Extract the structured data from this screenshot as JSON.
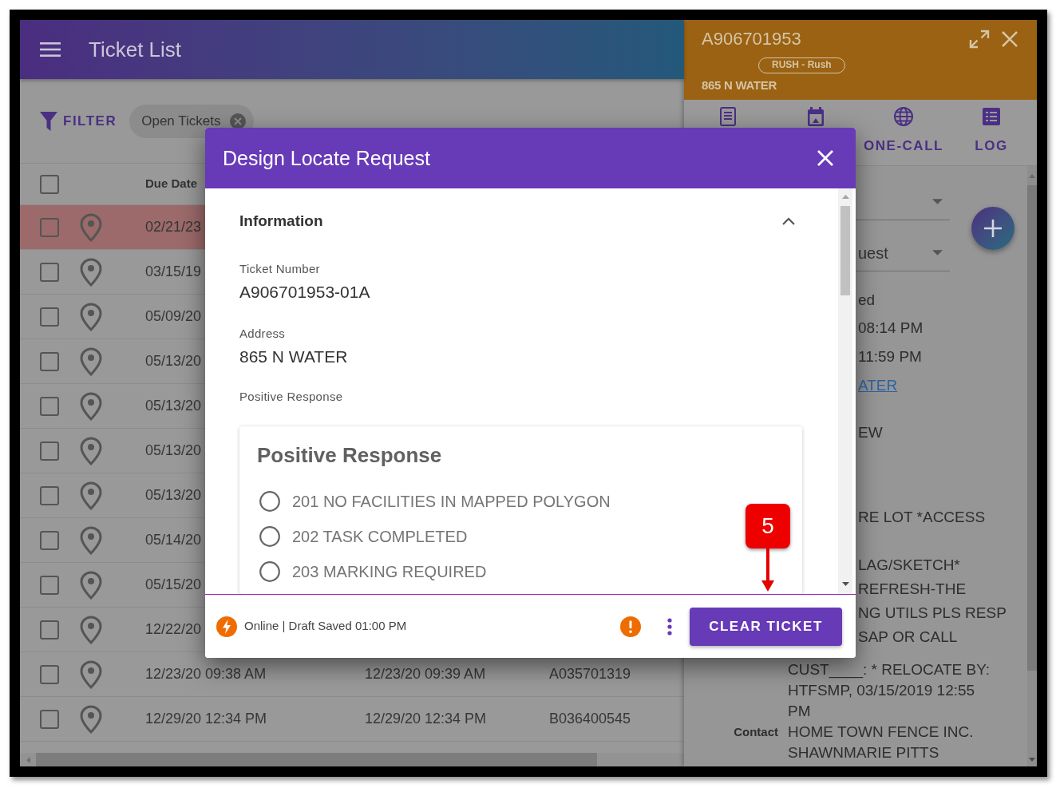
{
  "app_bar": {
    "title": "Ticket List"
  },
  "ticket_list": {
    "filter_label": "FILTER",
    "filter_chip": "Open Tickets",
    "all_checked": false,
    "columns": [
      "Due Date"
    ],
    "rows": [
      {
        "highlighted": true,
        "checked": false,
        "cells": [
          "02/21/23"
        ]
      },
      {
        "highlighted": false,
        "checked": false,
        "cells": [
          "03/15/19"
        ]
      },
      {
        "highlighted": false,
        "checked": false,
        "cells": [
          "05/09/20"
        ]
      },
      {
        "highlighted": false,
        "checked": false,
        "cells": [
          "05/13/20"
        ]
      },
      {
        "highlighted": false,
        "checked": false,
        "cells": [
          "05/13/20"
        ]
      },
      {
        "highlighted": false,
        "checked": false,
        "cells": [
          "05/13/20"
        ]
      },
      {
        "highlighted": false,
        "checked": false,
        "cells": [
          "05/13/20"
        ]
      },
      {
        "highlighted": false,
        "checked": false,
        "cells": [
          "05/14/20"
        ]
      },
      {
        "highlighted": false,
        "checked": false,
        "cells": [
          "05/15/20"
        ]
      },
      {
        "highlighted": false,
        "checked": false,
        "cells": [
          "12/22/20"
        ]
      },
      {
        "highlighted": false,
        "checked": false,
        "cells": [
          "12/23/20 09:38 AM",
          "12/23/20 09:39 AM",
          "A035701319"
        ]
      },
      {
        "highlighted": false,
        "checked": false,
        "cells": [
          "12/29/20 12:34 PM",
          "12/29/20 12:34 PM",
          "B036400545"
        ]
      }
    ]
  },
  "detail_panel": {
    "title": "A906701953",
    "badge": "RUSH - Rush",
    "address": "865 N WATER",
    "tabs": [
      {
        "kind": "notes"
      },
      {
        "kind": "calendar"
      },
      {
        "kind": "globe",
        "label": "ONE-CALL"
      },
      {
        "kind": "list",
        "label": "LOG"
      }
    ],
    "fields": [
      {
        "kind": "select"
      },
      {
        "kind": "select",
        "value": "uest"
      },
      {
        "kind": "text",
        "value": "ed"
      },
      {
        "kind": "text",
        "value": "08:14 PM"
      },
      {
        "kind": "text",
        "value": "11:59 PM"
      },
      {
        "kind": "link",
        "value": "ATER"
      },
      {
        "kind": "text",
        "value": "EW"
      },
      {
        "kind": "text",
        "value": "RE LOT *ACCESS"
      },
      {
        "kind": "text",
        "value": "LAG/SKETCH*"
      },
      {
        "kind": "text",
        "value": "REFRESH-THE"
      },
      {
        "kind": "text",
        "value": "NG UTILS PLS RESP"
      },
      {
        "kind": "text",
        "value": "SAP OR CALL"
      }
    ],
    "remarks": [
      "CUST____: * RELOCATE BY:",
      "HTFSMP, 03/15/2019 12:55",
      "PM"
    ],
    "contact": {
      "label": "Contact",
      "lines": [
        "HOME TOWN FENCE INC.",
        "SHAWNMARIE PITTS"
      ]
    }
  },
  "dialog": {
    "title": "Design Locate Request",
    "section": {
      "title": "Information",
      "expanded": true
    },
    "fields": [
      {
        "label": "Ticket Number",
        "value": "A906701953-01A"
      },
      {
        "label": "Address",
        "value": "865 N WATER"
      },
      {
        "label": "Positive Response"
      }
    ],
    "response_card": {
      "title": "Positive Response",
      "options": [
        {
          "label": "201 NO FACILITIES IN MAPPED POLYGON",
          "selected": false
        },
        {
          "label": "202 TASK COMPLETED",
          "selected": false
        },
        {
          "label": "203 MARKING REQUIRED",
          "selected": false
        }
      ]
    },
    "status": "Online | Draft Saved 01:00 PM",
    "action": "CLEAR TICKET"
  },
  "callout": {
    "label": "5"
  }
}
